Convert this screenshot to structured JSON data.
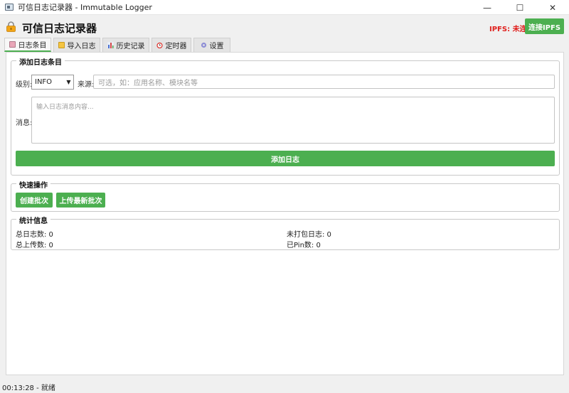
{
  "window": {
    "title": "可信日志记录器 - Immutable Logger",
    "controls": {
      "minimize": "—",
      "maximize": "☐",
      "close": "✕"
    }
  },
  "header": {
    "title": "可信日志记录器",
    "lock_icon": "lock-icon",
    "ipfs_status": "IPFS: 未连接",
    "ipfs_status_color": "#e0201d",
    "connect_button": "连接IPFS"
  },
  "tabs": [
    {
      "label": "日志条目",
      "icon": "memo-icon",
      "active": true
    },
    {
      "label": "导入日志",
      "icon": "folder-icon",
      "active": false
    },
    {
      "label": "历史记录",
      "icon": "bar-chart-icon",
      "active": false
    },
    {
      "label": "定时器",
      "icon": "alarm-clock-icon",
      "active": false
    },
    {
      "label": "设置",
      "icon": "gear-icon",
      "active": false
    }
  ],
  "add_entry": {
    "group_title": "添加日志条目",
    "level_label": "级别:",
    "level_value": "INFO",
    "source_label": "来源:",
    "source_placeholder": "可选，如：应用名称、模块名等",
    "message_label": "消息:",
    "message_placeholder": "输入日志消息内容...",
    "submit_button": "添加日志"
  },
  "quick_actions": {
    "group_title": "快速操作",
    "create_batch": "创建批次",
    "upload_latest": "上传最新批次"
  },
  "stats": {
    "group_title": "统计信息",
    "total_logs": "总日志数: 0",
    "unpacked_logs": "未打包日志: 0",
    "total_uploads": "总上传数: 0",
    "pinned": "已Pin数: 0"
  },
  "accent_color": "#4caf50",
  "status_bar": "00:13:28 - 就绪"
}
